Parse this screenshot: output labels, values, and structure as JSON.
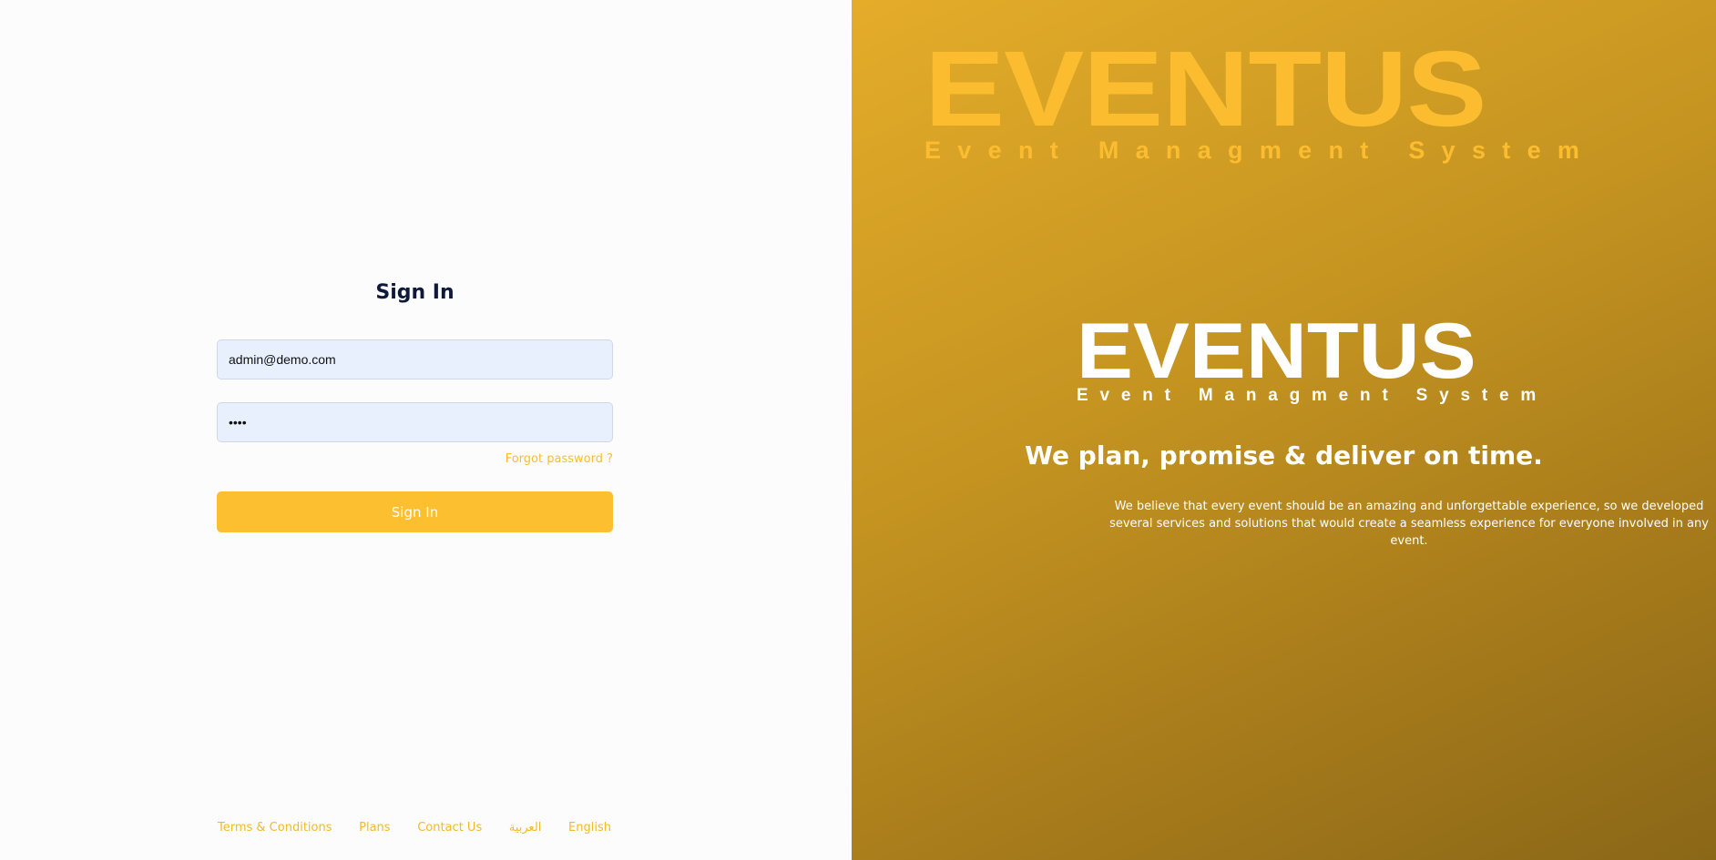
{
  "signin": {
    "title": "Sign In",
    "email_value": "admin@demo.com",
    "password_value": "demo",
    "forgot_label": "Forgot password ?",
    "button_label": "Sign In"
  },
  "footer": {
    "links": [
      {
        "label": "Terms & Conditions"
      },
      {
        "label": "Plans"
      },
      {
        "label": "Contact Us"
      },
      {
        "label": "العربية"
      },
      {
        "label": "English"
      }
    ]
  },
  "brand": {
    "name": "EVENTUS",
    "tagline": "Event Managment System",
    "headline": "We plan, promise & deliver on time.",
    "description": "We believe that every event should be an amazing and unforgettable experience, so we developed several services and solutions that would create a seamless experience for everyone involved in any event."
  },
  "colors": {
    "accent": "#fcbf30",
    "title": "#0f1a3a",
    "input_bg": "#e8f0fe"
  }
}
